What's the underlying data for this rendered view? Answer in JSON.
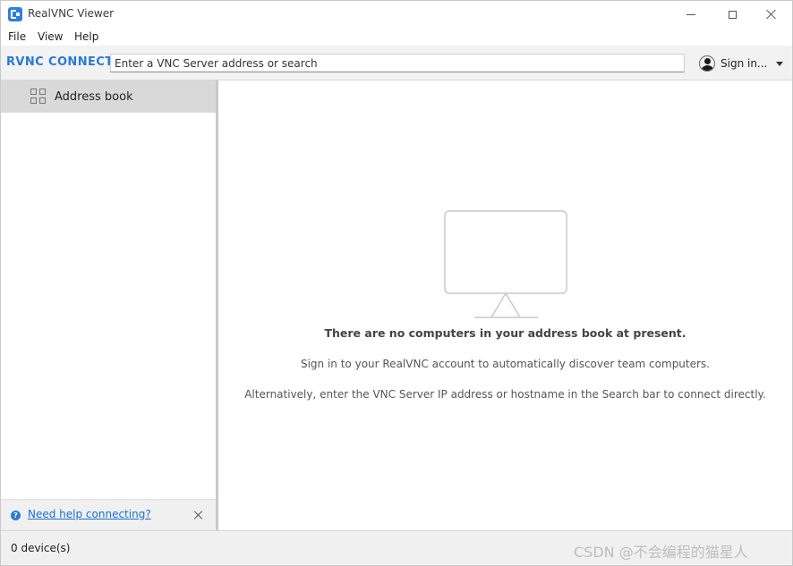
{
  "window": {
    "title": "RealVNC Viewer"
  },
  "menu": {
    "file": "File",
    "view": "View",
    "help": "Help"
  },
  "toolbar": {
    "logo_text": "RVNC CONNECT",
    "search_placeholder": "Enter a VNC Server address or search",
    "signin_label": "Sign in..."
  },
  "sidebar": {
    "items": [
      {
        "label": "Address book",
        "icon": "grid-icon",
        "selected": true
      }
    ],
    "help_link": "Need help connecting?"
  },
  "main": {
    "empty_title": "There are no computers in your address book at present.",
    "empty_line1": "Sign in to your RealVNC account to automatically discover team computers.",
    "empty_line2": "Alternatively, enter the VNC Server IP address or hostname in the Search bar to connect directly."
  },
  "status": {
    "device_count": "0 device(s)"
  },
  "watermark": "CSDN @不会编程的猫星人",
  "colors": {
    "accent": "#2a7ad0",
    "link": "#1a6fcf",
    "selected_bg": "#d9d9d9"
  }
}
